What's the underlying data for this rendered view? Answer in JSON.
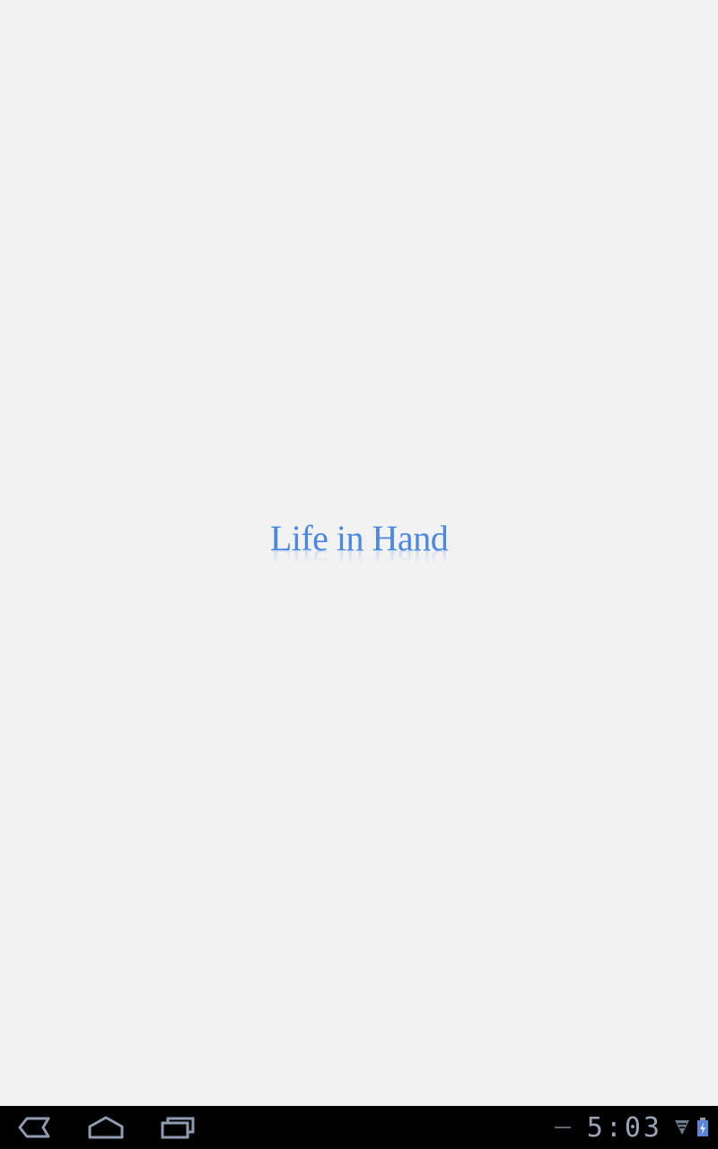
{
  "app": {
    "logo_text": "Life in Hand"
  },
  "system_bar": {
    "clock": "5:03",
    "icons": [
      "back-icon",
      "home-icon",
      "recent-apps-icon",
      "notification-dash-icon",
      "wifi-icon",
      "battery-charging-icon"
    ]
  },
  "colors": {
    "background": "#f2f2f2",
    "logo": "#4a88e6",
    "navbar": "#000000",
    "nav_icon": "#8f9bb0"
  }
}
